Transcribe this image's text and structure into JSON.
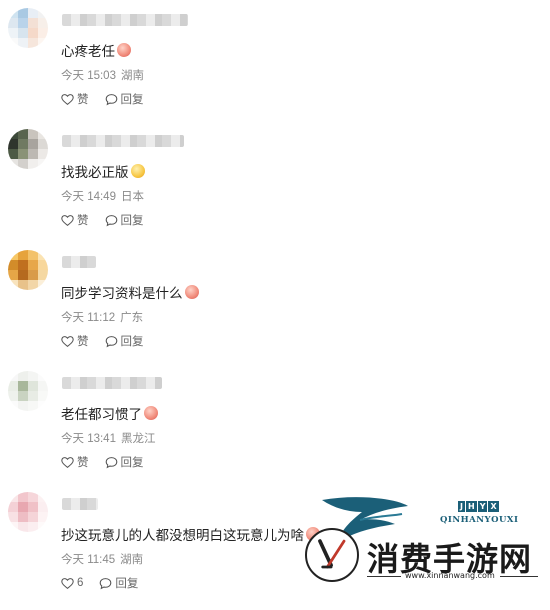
{
  "comments": [
    {
      "text": "心疼老任",
      "time": "今天 15:03",
      "location": "湖南",
      "like_label": "赞",
      "reply_label": "回复",
      "avatar_colors": [
        "#cfe3f0",
        "#a9c9e3",
        "#e8eef5",
        "#f2f2f2",
        "#dde7f0",
        "#b9d3ea",
        "#f3e0d5",
        "#f7efe9",
        "#eef3f7",
        "#d7e4ee",
        "#f5d9c9",
        "#fbeee6",
        "#fafafa",
        "#eef2f6",
        "#f6e6dc",
        "#fdf6f1"
      ],
      "name_width": 126
    },
    {
      "text": "找我必正版",
      "time": "今天 14:49",
      "location": "日本",
      "like_label": "赞",
      "reply_label": "回复",
      "avatar_colors": [
        "#3d4a3a",
        "#59644e",
        "#c9c4bd",
        "#e9e6e2",
        "#2f352d",
        "#707a62",
        "#a8a49e",
        "#dcd9d5",
        "#4d5a45",
        "#8a9276",
        "#bdb9b3",
        "#ece9e6",
        "#e6e4e1",
        "#d3d0cc",
        "#f1efed",
        "#f7f6f5"
      ],
      "name_width": 122
    },
    {
      "text": "同步学习资料是什么",
      "time": "今天 11:12",
      "location": "广东",
      "like_label": "赞",
      "reply_label": "回复",
      "avatar_colors": [
        "#f6c766",
        "#e6a33c",
        "#f3c26a",
        "#fbe3b2",
        "#d28c2a",
        "#c0701f",
        "#e7a74a",
        "#f8d79b",
        "#e5a647",
        "#b56a1f",
        "#d99b49",
        "#f5d8a2",
        "#f8e3bd",
        "#e8c28a",
        "#f2d6a8",
        "#fbefd9"
      ],
      "name_width": 34
    },
    {
      "text": "老任都习惯了",
      "time": "今天 13:41",
      "location": "黑龙江",
      "like_label": "赞",
      "reply_label": "回复",
      "avatar_colors": [
        "#f7f7f7",
        "#eef0ec",
        "#f4f5f3",
        "#fbfbfb",
        "#e9ede6",
        "#a8b79b",
        "#dfe5db",
        "#f5f6f4",
        "#eef1ec",
        "#c9d3c1",
        "#e8ece5",
        "#f8f9f7",
        "#fbfbfb",
        "#f3f4f2",
        "#f7f8f6",
        "#fdfdfd"
      ],
      "name_width": 100
    },
    {
      "text": "抄这玩意儿的人都没想明白这玩意儿为啥",
      "time": "今天 11:45",
      "location": "湖南",
      "like_label": "6",
      "reply_label": "回复",
      "avatar_colors": [
        "#f9e6e8",
        "#f2c6cc",
        "#f6d6da",
        "#fcf1f2",
        "#f4d1d6",
        "#e8a7b0",
        "#f0c1c7",
        "#fbeef0",
        "#f8e1e4",
        "#eebdc4",
        "#f5d4d8",
        "#fdf3f4",
        "#fdf5f6",
        "#f9e7ea",
        "#fbeef0",
        "#fefafa"
      ],
      "name_width": 36
    }
  ],
  "watermark": {
    "brand": "消费手游网",
    "url": "www.xinnanwang.com",
    "pinyin": "QINHANYOUXI",
    "badge_letters": [
      "J",
      "H",
      "Y",
      "X"
    ],
    "colors": {
      "teal": "#1b5f78",
      "red": "#c0392b"
    }
  }
}
